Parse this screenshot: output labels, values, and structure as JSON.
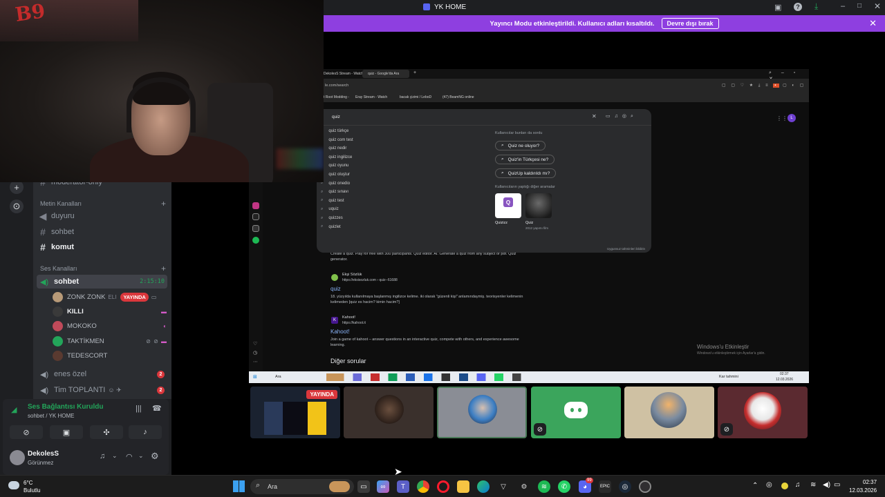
{
  "app": {
    "title": "YK HOME"
  },
  "notice": {
    "message": "Yayıncı Modu etkinleştirildi. Kullanıcı adları kısaltıldı.",
    "button": "Devre dışı bırak"
  },
  "webcam": {
    "scrawl": "B9"
  },
  "channels": {
    "partial_channel": "moderator-only",
    "text_category": "Metin Kanalları",
    "text_channels": [
      "duyuru",
      "sohbet",
      "komut"
    ],
    "voice_category": "Ses Kanalları",
    "voice_channel": "sohbet",
    "voice_timer": "2:15:10",
    "users": [
      {
        "name": "ZONK ZONK",
        "suffix": "ELI",
        "live": "YAYINDA"
      },
      {
        "name": "KILLI"
      },
      {
        "name": "MOKOKO"
      },
      {
        "name": "TAKTİKMEN"
      },
      {
        "name": "TEDESCORT"
      }
    ],
    "other_channels": [
      {
        "name": "enes özel",
        "badge": "2"
      },
      {
        "name": "Tim TOPLANTI",
        "badge": "2"
      }
    ]
  },
  "voice_panel": {
    "status": "Ses Bağlantısı Kuruldu",
    "location": "sohbet / YK HOME"
  },
  "user_panel": {
    "name": "DekolesS",
    "status": "Görünmez"
  },
  "shared_screen": {
    "tabs": [
      "DekolesS Stream - Watch",
      "quiz - Google'da Ara"
    ],
    "address": "le.com/search",
    "bookmarks": [
      "t Root Modding -",
      "Eray Stream - Watch",
      "bacak çizimi / LeboD",
      "(47) BeamNG online"
    ],
    "search_query": "quiz",
    "suggestions": [
      "quiz türkçe",
      "quiz com test",
      "quiz nedir",
      "quiz ingilizce",
      "quiz oyunu",
      "quiz oluştur",
      "quiz onedio",
      "quiz sınavı",
      "quiz test",
      "uquiz",
      "quizzes",
      "quizlet"
    ],
    "people_ask_header": "Kullanıcılar bunları da sordu",
    "people_ask": [
      "Quiz ne oluyor?",
      "Quiz'in Türkçesi ne?",
      "QuizUp kaldırıldı mı?"
    ],
    "other_searches_header": "Kullanıcıların yaptığı diğer aramalar",
    "other_searches": [
      "Quizizz",
      "Quiz"
    ],
    "other_searches_sub": "2012 yapımı film",
    "feedback": "Uygunsuz tahminleri bildirin",
    "result_intro": "Create a quiz. Play for free with 300 participants. Quiz editor. AI. Generate a quiz from any subject or pdf. Quiz generator.",
    "result1": {
      "source": "Ekşi Sözlük",
      "url": "https://eksisozluk.com › quiz--61688",
      "title": "quiz",
      "text": "18. yüzyılda kullanılmaya başlanmış ingilizce kelime. iki olarak \"güzenli kişi\" anlamındaymiş. teorisyenler kelimenin kelimeden [quiz es hacim? kimin hacim?]"
    },
    "result2": {
      "source": "Kahoot!",
      "url": "https://kahoot.it",
      "title": "Kahoot!",
      "text": "Join a game of kahoot – answer questions in an interactive quiz, compete with others, and experience awesome learning."
    },
    "diger_sorular": "Diğer sorular",
    "windows_activate_title": "Windows'u Etkinleştir",
    "windows_activate_sub": "Windows'u etkinleştirmek için Ayarlar'a gidin.",
    "taskbar_search": "Ara",
    "taskbar_weather": "Kar tahmini",
    "taskbar_time": "02:37",
    "taskbar_date": "12.03.2026"
  },
  "tiles": [
    {
      "kind": "stream",
      "live": "YAYINDA"
    },
    {
      "kind": "avatar",
      "color": "#3a2a24"
    },
    {
      "kind": "avatar",
      "color": "#8a8a92",
      "selected": true
    },
    {
      "kind": "discord",
      "color": "#3ba55c"
    },
    {
      "kind": "avatar",
      "color": "#cfc1a3"
    },
    {
      "kind": "avatar",
      "color": "#5b2a30"
    }
  ],
  "taskbar": {
    "weather_temp": "6°C",
    "weather_desc": "Bulutlu",
    "search": "Ara",
    "time": "02:37",
    "date": "12.03.2026",
    "discord_badge": "99"
  }
}
